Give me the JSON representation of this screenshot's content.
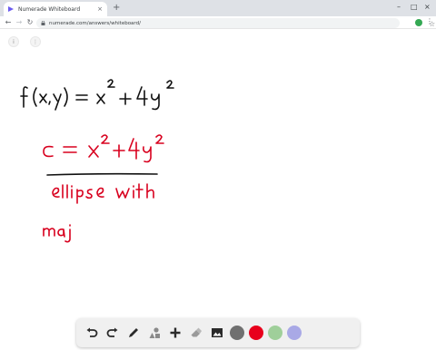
{
  "browser": {
    "tab_title": "Numerade Whiteboard",
    "tab_close": "×",
    "new_tab": "+",
    "url": "numerade.com/answers/whiteboard/",
    "window_controls": {
      "minimize": "–",
      "maximize": "□",
      "close": "×"
    }
  },
  "whiteboard": {
    "handwriting": [
      {
        "color": "black",
        "text": "f(x,y) = x^2 + 4y^2"
      },
      {
        "color": "red",
        "text": "c = x^2 + 4y^2"
      },
      {
        "color": "red",
        "text": "ellipse with"
      },
      {
        "color": "red",
        "text": "maj"
      }
    ]
  },
  "tools": {
    "icons": [
      "undo-icon",
      "redo-icon",
      "pencil-icon",
      "shapes-icon",
      "plus-icon",
      "eraser-icon",
      "image-icon"
    ],
    "colors": [
      "#707070",
      "#e8001c",
      "#9fcf9a",
      "#a9a9e6"
    ]
  }
}
